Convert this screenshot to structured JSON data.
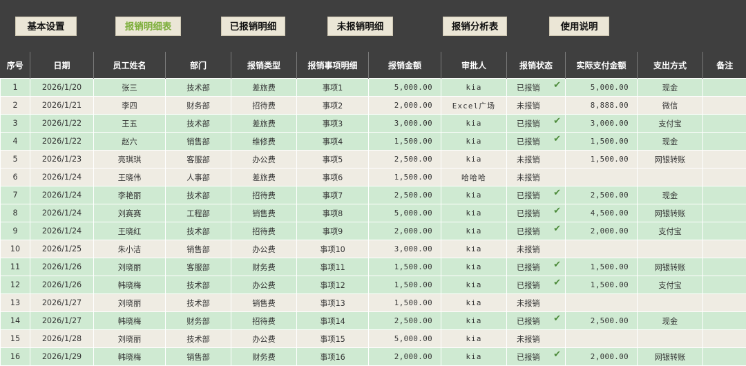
{
  "nav": {
    "buttons": [
      {
        "label": "基本设置",
        "active": false
      },
      {
        "label": "报销明细表",
        "active": true
      },
      {
        "label": "已报销明细",
        "active": false
      },
      {
        "label": "未报销明细",
        "active": false
      },
      {
        "label": "报销分析表",
        "active": false
      },
      {
        "label": "使用说明",
        "active": false
      }
    ]
  },
  "table": {
    "headers": [
      "序号",
      "日期",
      "员工姓名",
      "部门",
      "报销类型",
      "报销事项明细",
      "报销金额",
      "审批人",
      "报销状态",
      "实际支付金额",
      "支出方式",
      "备注"
    ],
    "rows": [
      {
        "idx": "1",
        "date": "2026/1/20",
        "name": "张三",
        "dept": "技术部",
        "type": "差旅费",
        "item": "事项1",
        "amount": "5,000.00",
        "approver": "kia",
        "status": "已报销",
        "paid": "5,000.00",
        "method": "现金",
        "note": ""
      },
      {
        "idx": "2",
        "date": "2026/1/21",
        "name": "李四",
        "dept": "财务部",
        "type": "招待费",
        "item": "事项2",
        "amount": "2,000.00",
        "approver": "Excel广场",
        "status": "未报销",
        "paid": "8,888.00",
        "method": "微信",
        "note": ""
      },
      {
        "idx": "3",
        "date": "2026/1/22",
        "name": "王五",
        "dept": "技术部",
        "type": "差旅费",
        "item": "事项3",
        "amount": "3,000.00",
        "approver": "kia",
        "status": "已报销",
        "paid": "3,000.00",
        "method": "支付宝",
        "note": ""
      },
      {
        "idx": "4",
        "date": "2026/1/22",
        "name": "赵六",
        "dept": "销售部",
        "type": "维修费",
        "item": "事项4",
        "amount": "1,500.00",
        "approver": "kia",
        "status": "已报销",
        "paid": "1,500.00",
        "method": "现金",
        "note": ""
      },
      {
        "idx": "5",
        "date": "2026/1/23",
        "name": "亮琪琪",
        "dept": "客服部",
        "type": "办公费",
        "item": "事项5",
        "amount": "2,500.00",
        "approver": "kia",
        "status": "未报销",
        "paid": "1,500.00",
        "method": "网银转账",
        "note": ""
      },
      {
        "idx": "6",
        "date": "2026/1/24",
        "name": "王晓伟",
        "dept": "人事部",
        "type": "差旅费",
        "item": "事项6",
        "amount": "1,500.00",
        "approver": "哈哈哈",
        "status": "未报销",
        "paid": "",
        "method": "",
        "note": ""
      },
      {
        "idx": "7",
        "date": "2026/1/24",
        "name": "李艳丽",
        "dept": "技术部",
        "type": "招待费",
        "item": "事项7",
        "amount": "2,500.00",
        "approver": "kia",
        "status": "已报销",
        "paid": "2,500.00",
        "method": "现金",
        "note": ""
      },
      {
        "idx": "8",
        "date": "2026/1/24",
        "name": "刘赛赛",
        "dept": "工程部",
        "type": "销售费",
        "item": "事项8",
        "amount": "5,000.00",
        "approver": "kia",
        "status": "已报销",
        "paid": "4,500.00",
        "method": "网银转账",
        "note": ""
      },
      {
        "idx": "9",
        "date": "2026/1/24",
        "name": "王晓红",
        "dept": "技术部",
        "type": "招待费",
        "item": "事项9",
        "amount": "2,000.00",
        "approver": "kia",
        "status": "已报销",
        "paid": "2,000.00",
        "method": "支付宝",
        "note": ""
      },
      {
        "idx": "10",
        "date": "2026/1/25",
        "name": "朱小洁",
        "dept": "销售部",
        "type": "办公费",
        "item": "事项10",
        "amount": "3,000.00",
        "approver": "kia",
        "status": "未报销",
        "paid": "",
        "method": "",
        "note": ""
      },
      {
        "idx": "11",
        "date": "2026/1/26",
        "name": "刘晓丽",
        "dept": "客服部",
        "type": "财务费",
        "item": "事项11",
        "amount": "1,500.00",
        "approver": "kia",
        "status": "已报销",
        "paid": "1,500.00",
        "method": "网银转账",
        "note": ""
      },
      {
        "idx": "12",
        "date": "2026/1/26",
        "name": "韩晓梅",
        "dept": "技术部",
        "type": "办公费",
        "item": "事项12",
        "amount": "1,500.00",
        "approver": "kia",
        "status": "已报销",
        "paid": "1,500.00",
        "method": "支付宝",
        "note": ""
      },
      {
        "idx": "13",
        "date": "2026/1/27",
        "name": "刘晓丽",
        "dept": "技术部",
        "type": "销售费",
        "item": "事项13",
        "amount": "1,500.00",
        "approver": "kia",
        "status": "未报销",
        "paid": "",
        "method": "",
        "note": ""
      },
      {
        "idx": "14",
        "date": "2026/1/27",
        "name": "韩晓梅",
        "dept": "财务部",
        "type": "招待费",
        "item": "事项14",
        "amount": "2,500.00",
        "approver": "kia",
        "status": "已报销",
        "paid": "2,500.00",
        "method": "现金",
        "note": ""
      },
      {
        "idx": "15",
        "date": "2026/1/28",
        "name": "刘晓丽",
        "dept": "技术部",
        "type": "办公费",
        "item": "事项15",
        "amount": "5,000.00",
        "approver": "kia",
        "status": "未报销",
        "paid": "",
        "method": "",
        "note": ""
      },
      {
        "idx": "16",
        "date": "2026/1/29",
        "name": "韩晓梅",
        "dept": "销售部",
        "type": "财务费",
        "item": "事项16",
        "amount": "2,000.00",
        "approver": "kia",
        "status": "已报销",
        "paid": "2,000.00",
        "method": "网银转账",
        "note": ""
      }
    ]
  },
  "colors": {
    "header_bg": "#3f3f3f",
    "row_green": "#cfead2",
    "row_beige": "#efece3",
    "active_nav": "#7cae3a",
    "check_mark": "#4d8b3b"
  },
  "icons": {
    "paid_status": "check-mark-icon"
  }
}
